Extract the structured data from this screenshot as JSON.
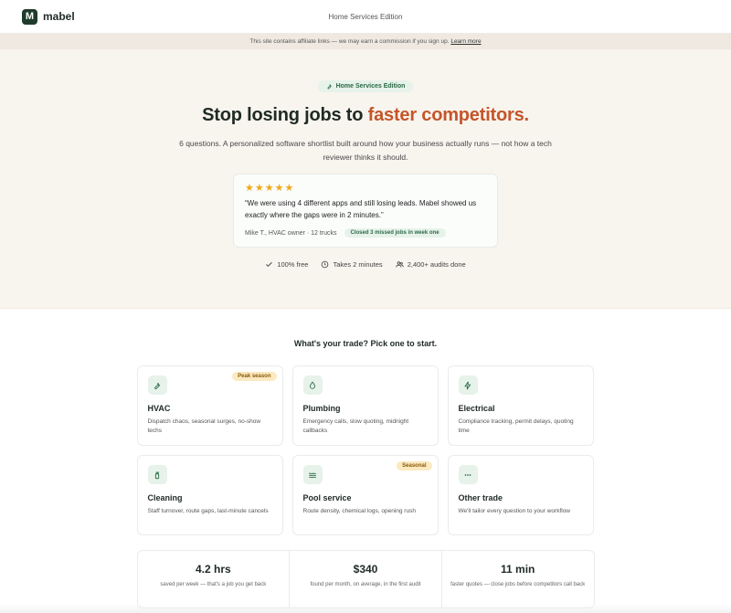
{
  "brand": {
    "logo_letter": "M",
    "name": "mabel"
  },
  "header": {
    "edition": "Home Services Edition"
  },
  "affiliate": {
    "text": "This site contains affiliate links — we may earn a commission if you sign up.",
    "link": "Learn more"
  },
  "hero": {
    "pill": "Home Services Edition",
    "title_plain": "Stop losing jobs to ",
    "title_accent": "faster competitors.",
    "subtitle": "6 questions. A personalized software shortlist built around how your business actually runs — not how a tech reviewer thinks it should.",
    "testimonial": {
      "stars": "★★★★★",
      "rating": 5,
      "quote": "“We were using 4 different apps and still losing leads. Mabel showed us exactly where the gaps were in 2 minutes.”",
      "author": "Mike T., HVAC owner · 12 trucks",
      "badge": "Closed 3 missed jobs in week one"
    },
    "trust": [
      {
        "icon": "check-icon",
        "label": "100% free"
      },
      {
        "icon": "clock-icon",
        "label": "Takes 2 minutes"
      },
      {
        "icon": "users-icon",
        "label": "2,400+ audits done"
      }
    ]
  },
  "trades": {
    "heading": "What's your trade? Pick one to start.",
    "cards": [
      {
        "icon": "wrench-icon",
        "title": "HVAC",
        "desc": "Dispatch chaos, seasonal surges, no-show techs",
        "badge": "Peak season"
      },
      {
        "icon": "droplet-icon",
        "title": "Plumbing",
        "desc": "Emergency calls, slow quoting, midnight callbacks",
        "badge": ""
      },
      {
        "icon": "bolt-icon",
        "title": "Electrical",
        "desc": "Compliance tracking, permit delays, quoting time",
        "badge": ""
      },
      {
        "icon": "spray-bottle-icon",
        "title": "Cleaning",
        "desc": "Staff turnover, route gaps, last-minute cancels",
        "badge": ""
      },
      {
        "icon": "waves-icon",
        "title": "Pool service",
        "desc": "Route density, chemical logs, opening rush",
        "badge": "Seasonal"
      },
      {
        "icon": "dots-icon",
        "title": "Other trade",
        "desc": "We'll tailor every question to your workflow",
        "badge": ""
      }
    ]
  },
  "stats": [
    {
      "value": "4.2 hrs",
      "label": "saved per week — that's a job you get back"
    },
    {
      "value": "$340",
      "label": "found per month, on average, in the first audit"
    },
    {
      "value": "11 min",
      "label": "faster quotes — close jobs before competitors call back"
    }
  ],
  "colors": {
    "brand_dark": "#1f3b2c",
    "accent": "#c4562a",
    "green_soft": "#e6f2ea",
    "hero_bg": "#f8f4ee",
    "badge_yellow": "#fbe9bf",
    "star": "#f0a91b"
  }
}
